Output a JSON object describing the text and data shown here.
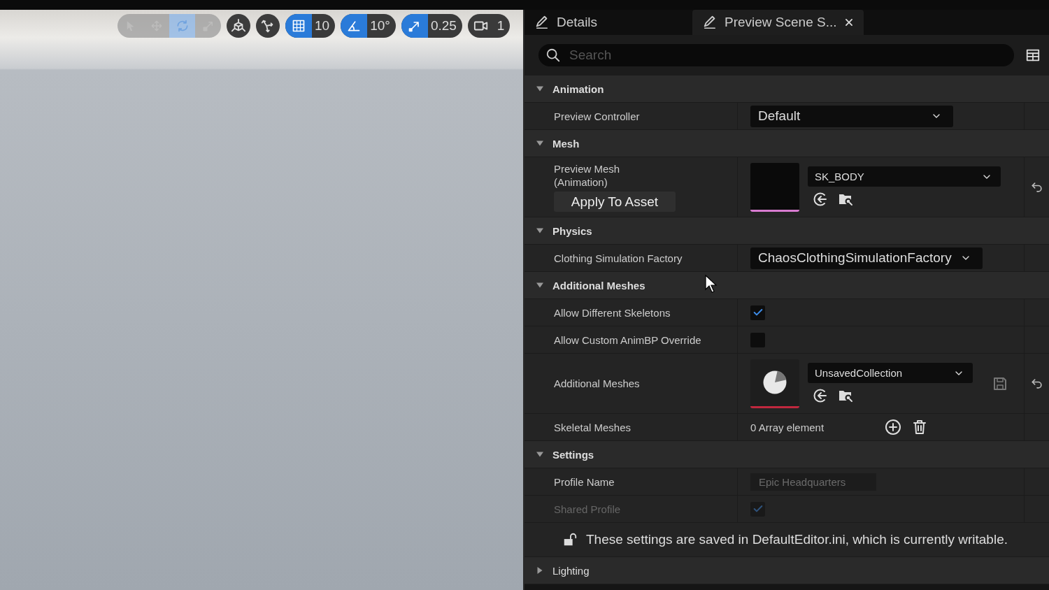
{
  "viewport": {
    "transform_tools": [
      {
        "kind": "select",
        "selected": false
      },
      {
        "kind": "move",
        "selected": false
      },
      {
        "kind": "rotate",
        "selected": true
      },
      {
        "kind": "scale",
        "selected": false
      }
    ],
    "snaps": [
      {
        "kind": "grid",
        "on": true,
        "value": "10"
      },
      {
        "kind": "angle",
        "on": true,
        "value": "10°"
      },
      {
        "kind": "scale",
        "on": true,
        "value": "0.25"
      },
      {
        "kind": "camera",
        "on": false,
        "value": "1"
      }
    ]
  },
  "tabs": [
    {
      "label": "Details",
      "selected": false,
      "closable": false
    },
    {
      "label": "Preview Scene S...",
      "selected": true,
      "closable": true
    }
  ],
  "search": {
    "placeholder": "Search"
  },
  "sections": [
    {
      "title": "Animation",
      "expanded": true,
      "rows": [
        {
          "kind": "dropdown",
          "label": "Preview Controller",
          "value": "Default",
          "reset": false
        }
      ]
    },
    {
      "title": "Mesh",
      "expanded": true,
      "rows": [
        {
          "kind": "mesh_asset",
          "label": "Preview Mesh\n(Animation)",
          "button": "Apply To Asset",
          "value": "SK_BODY",
          "reset": true
        }
      ]
    },
    {
      "title": "Physics",
      "expanded": true,
      "rows": [
        {
          "kind": "dropdown",
          "label": "Clothing Simulation Factory",
          "value": "ChaosClothingSimulationFactory",
          "reset": false
        }
      ]
    },
    {
      "title": "Additional Meshes",
      "expanded": true,
      "rows": [
        {
          "kind": "checkbox",
          "label": "Allow Different Skeletons",
          "checked": true,
          "disabled": false
        },
        {
          "kind": "checkbox",
          "label": "Allow Custom AnimBP Override",
          "checked": false,
          "disabled": false
        },
        {
          "kind": "collection_asset",
          "label": "Additional Meshes",
          "value": "UnsavedCollection",
          "save": true,
          "reset": true
        },
        {
          "kind": "array",
          "label": "Skeletal Meshes",
          "value": "0 Array element"
        }
      ]
    },
    {
      "title": "Settings",
      "expanded": true,
      "rows": [
        {
          "kind": "text",
          "label": "Profile Name",
          "value": "Epic Headquarters",
          "disabled": true
        },
        {
          "kind": "checkbox",
          "label": "Shared Profile",
          "checked": true,
          "disabled": true
        },
        {
          "kind": "notice",
          "text": "These settings are saved in DefaultEditor.ini, which is currently writable."
        }
      ]
    },
    {
      "title": "Lighting",
      "expanded": false
    }
  ]
}
